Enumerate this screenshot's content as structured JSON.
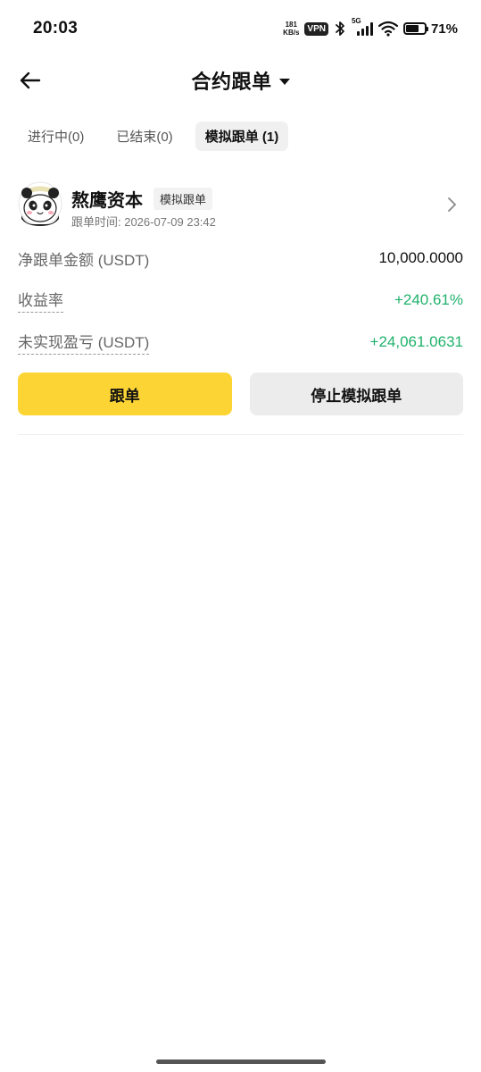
{
  "status_bar": {
    "time": "20:03",
    "net_speed_value": "181",
    "net_speed_unit": "KB/s",
    "vpn": "VPN",
    "network": "5G",
    "battery_percent": "71%",
    "battery_level": 0.71
  },
  "header": {
    "title": "合约跟单",
    "back_icon": "arrow-left-icon",
    "dropdown_icon": "caret-down-icon"
  },
  "tabs": [
    {
      "label": "进行中(0)",
      "active": false
    },
    {
      "label": "已结束(0)",
      "active": false
    },
    {
      "label": "模拟跟单 (1)",
      "active": true
    }
  ],
  "trader": {
    "name": "熬鹰资本",
    "badge": "模拟跟单",
    "follow_time": "跟单时间: 2026-07-09 23:42",
    "avatar_icon": "panda-avatar-icon",
    "chevron_icon": "chevron-right-icon"
  },
  "stats": {
    "net_amount_label": "净跟单金额 (USDT)",
    "net_amount_value": "10,000.0000",
    "yield_label": "收益率",
    "yield_value": "+240.61%",
    "unrealized_label": "未实现盈亏 (USDT)",
    "unrealized_value": "+24,061.0631"
  },
  "actions": {
    "follow_label": "跟单",
    "stop_label": "停止模拟跟单"
  },
  "colors": {
    "accent_yellow": "#fcd535",
    "profit_green": "#20b26c",
    "tab_active_bg": "#f0f0f0"
  }
}
